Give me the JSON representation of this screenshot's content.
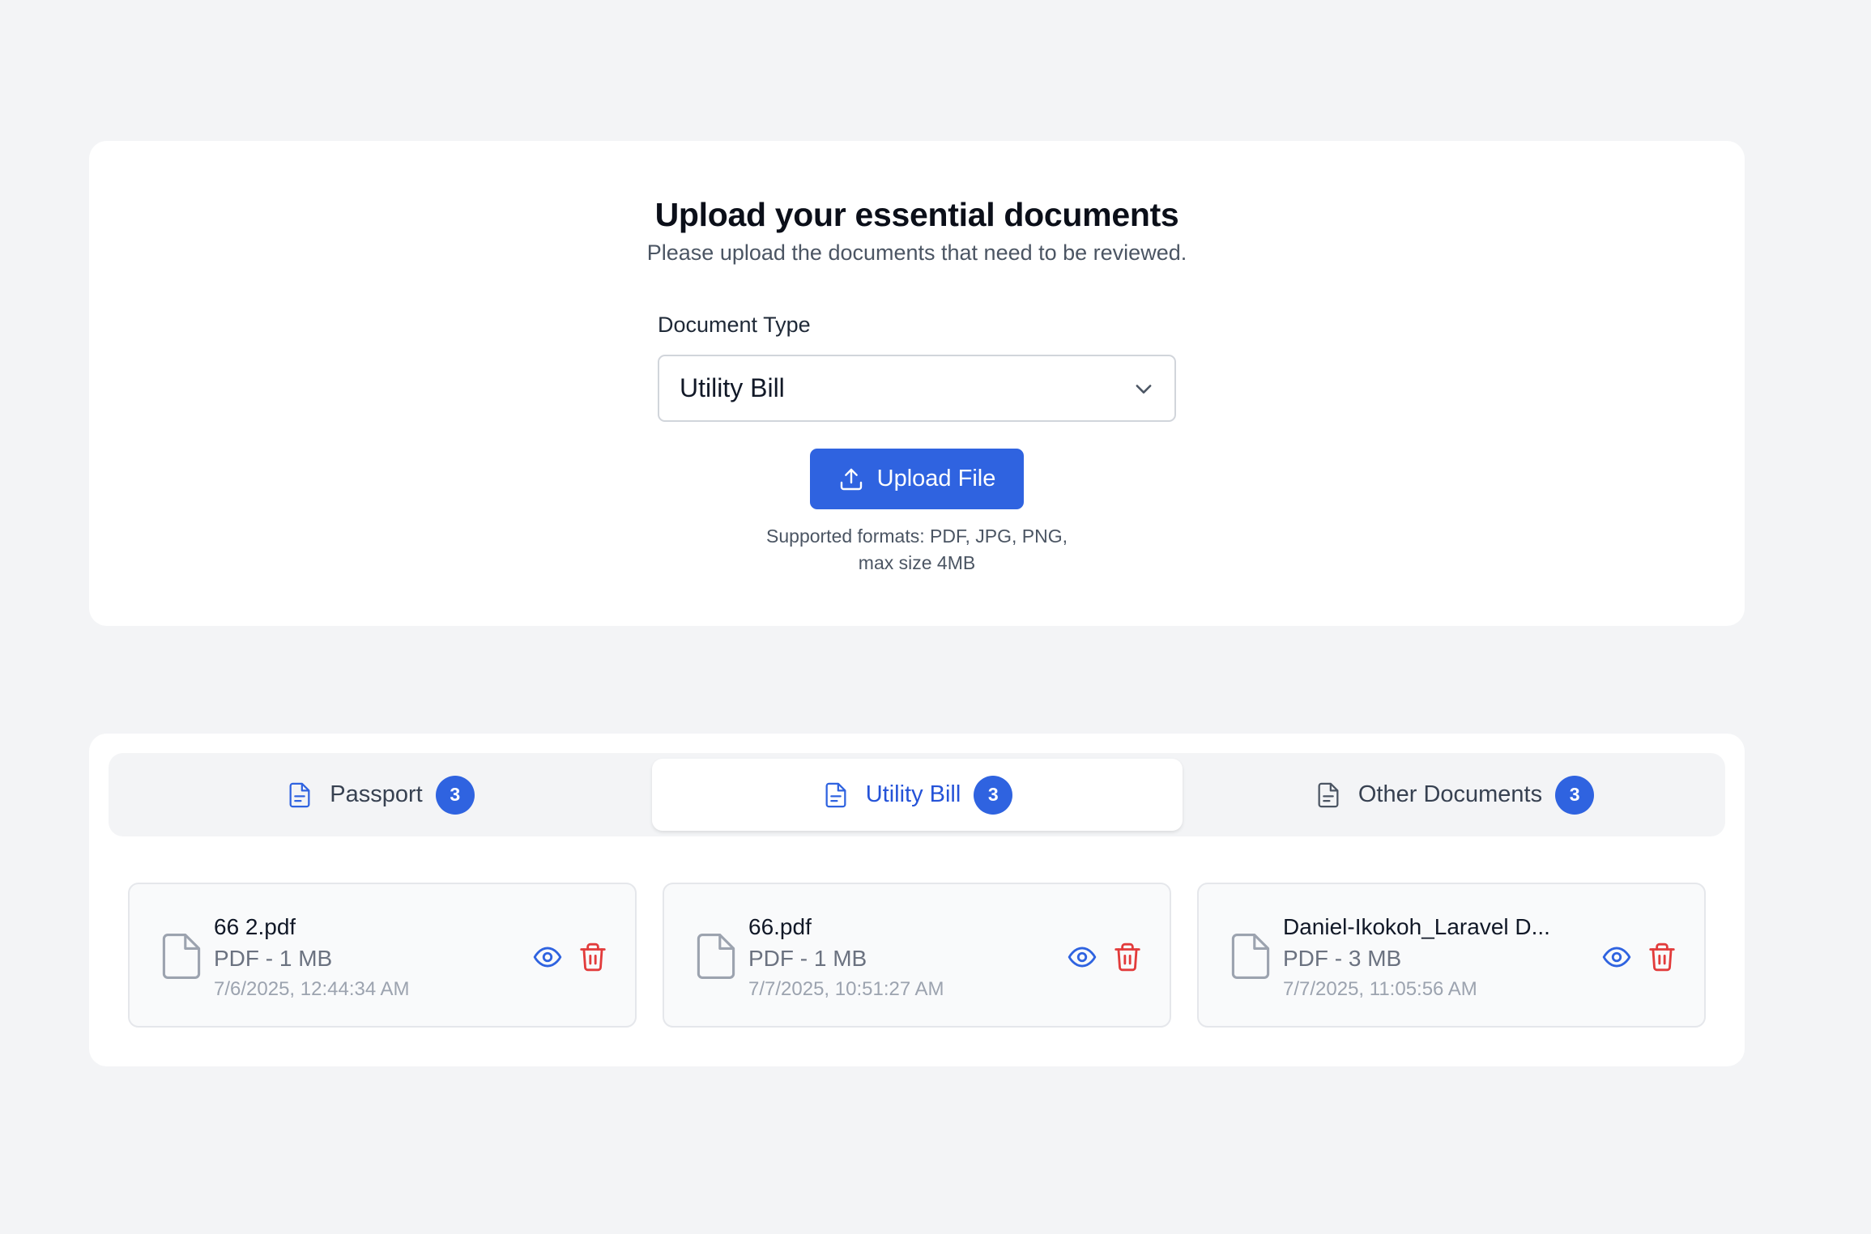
{
  "upload": {
    "title": "Upload your essential documents",
    "subtitle": "Please upload the documents that need to be reviewed.",
    "document_type_label": "Document Type",
    "document_type_value": "Utility Bill",
    "upload_button_label": "Upload File",
    "hint_line1": "Supported formats: PDF, JPG, PNG,",
    "hint_line2": "max size 4MB"
  },
  "tabs": [
    {
      "label": "Passport",
      "count": "3",
      "active": false
    },
    {
      "label": "Utility Bill",
      "count": "3",
      "active": true
    },
    {
      "label": "Other Documents",
      "count": "3",
      "active": false
    }
  ],
  "files": [
    {
      "name": "66 2.pdf",
      "meta": "PDF - 1 MB",
      "date": "7/6/2025, 12:44:34 AM"
    },
    {
      "name": "66.pdf",
      "meta": "PDF - 1 MB",
      "date": "7/7/2025, 10:51:27 AM"
    },
    {
      "name": "Daniel-Ikokoh_Laravel D...",
      "meta": "PDF - 3 MB",
      "date": "7/7/2025, 11:05:56 AM"
    }
  ],
  "colors": {
    "accent": "#2f63e0",
    "active_tab_text": "#2553d8",
    "delete_red": "#e23b3b",
    "page_bg": "#f3f4f6"
  },
  "icons": {
    "select_chevron": "chevron-down-icon",
    "upload": "upload-icon",
    "tab_document": "document-icon",
    "file": "file-icon",
    "view": "eye-icon",
    "delete": "trash-icon"
  }
}
